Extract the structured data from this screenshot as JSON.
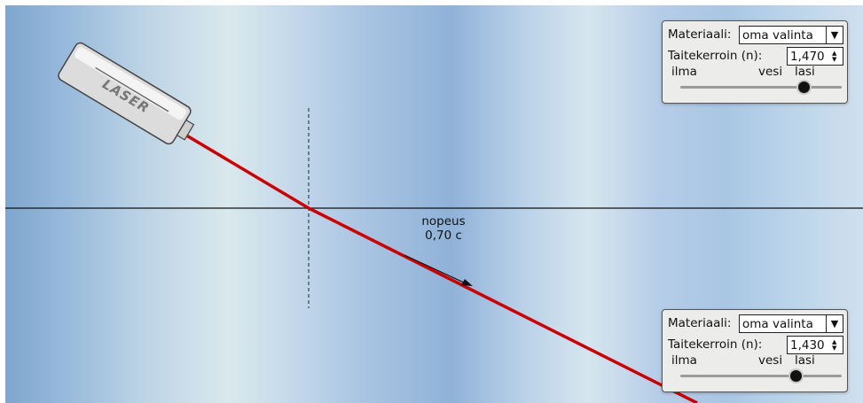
{
  "scene": {
    "speed_label": "nopeus",
    "speed_value": "0,70 c",
    "laser_label": "LASER",
    "beam_color": "#cc0000"
  },
  "top_panel": {
    "material_label": "Materiaali:",
    "material_value": "oma valinta",
    "index_label": "Taitekerroin (n):",
    "index_value": "1,470",
    "slider_labels": [
      "ilma",
      "vesi",
      "lasi"
    ],
    "slider_value": 1.47
  },
  "bottom_panel": {
    "material_label": "Materiaali:",
    "material_value": "oma valinta",
    "index_label": "Taitekerroin (n):",
    "index_value": "1,430",
    "slider_labels": [
      "ilma",
      "vesi",
      "lasi"
    ],
    "slider_value": 1.43
  },
  "icons": {
    "dropdown": "▼",
    "spin_up": "▲",
    "spin_down": "▼"
  }
}
